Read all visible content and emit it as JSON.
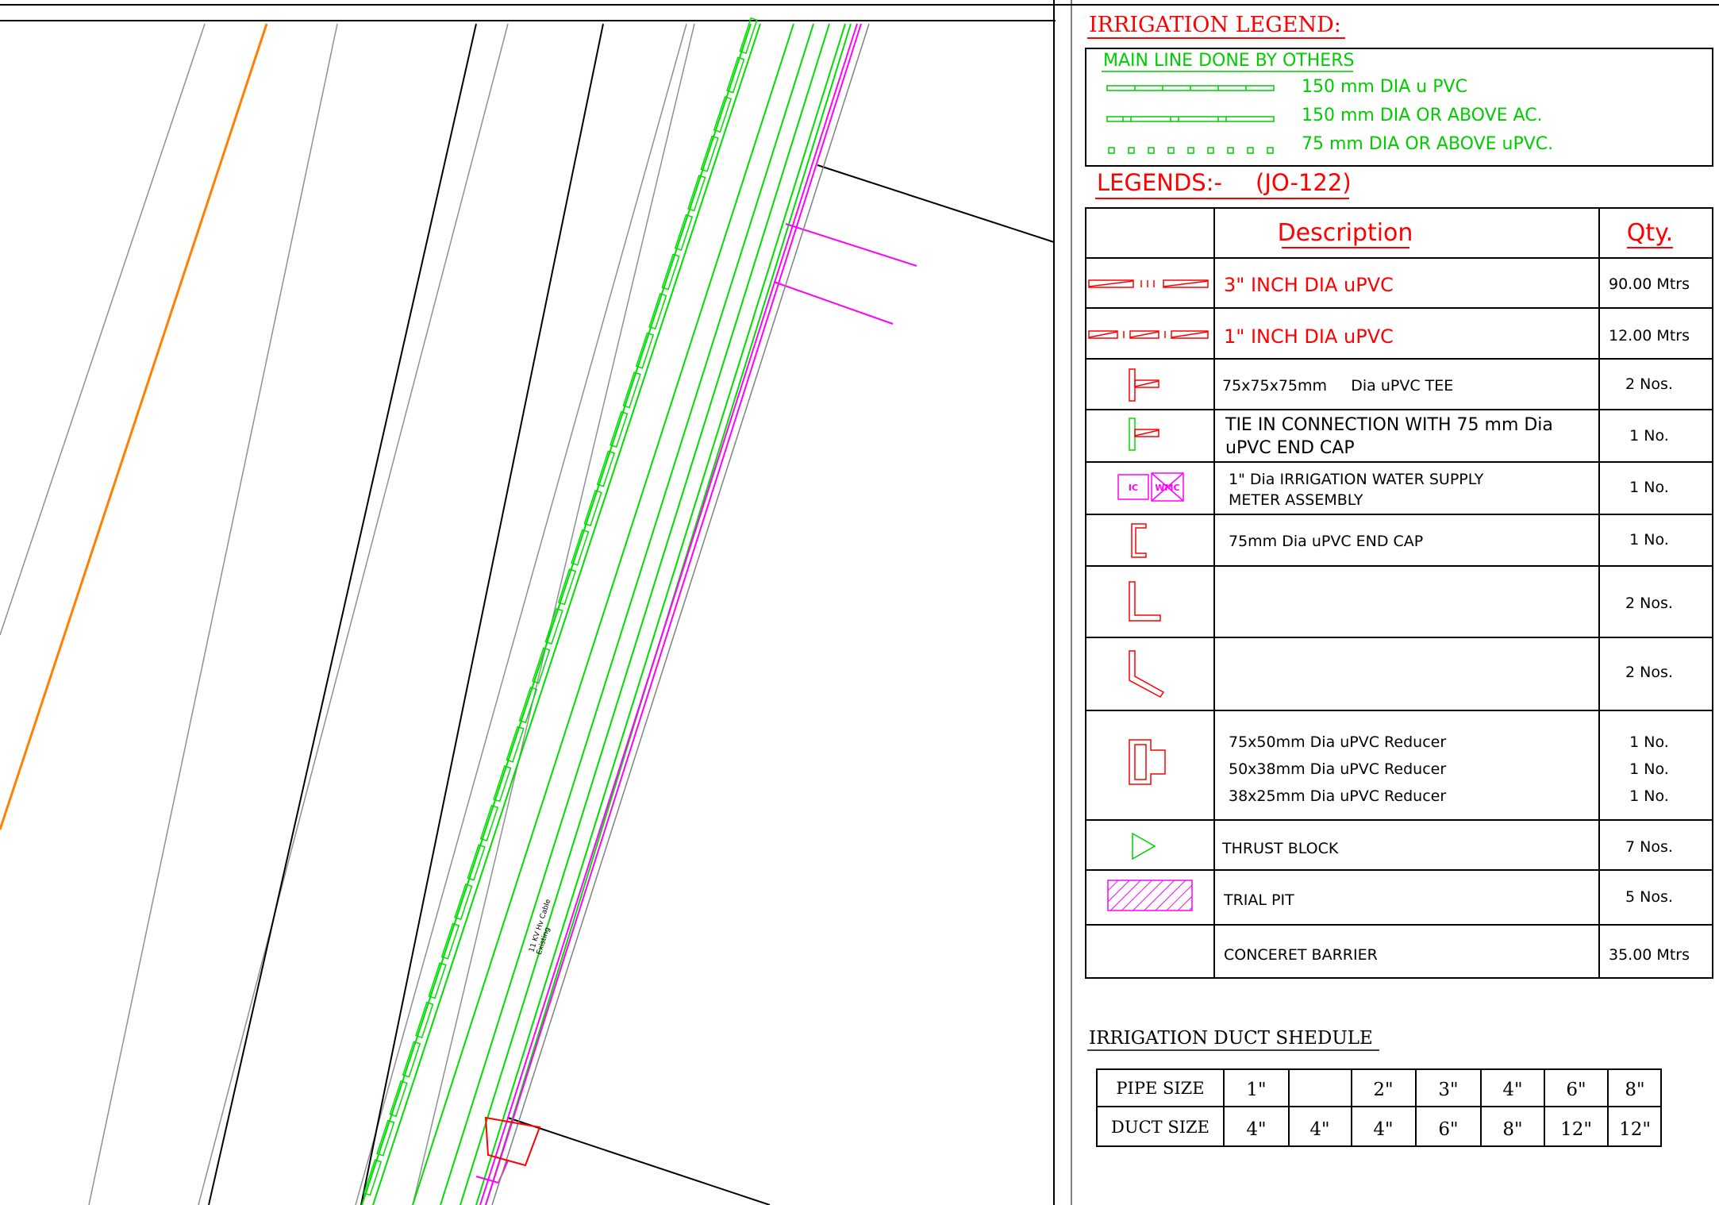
{
  "colors": {
    "red": "#ff0000",
    "green": "#00dd00",
    "magenta": "#ff00ff",
    "orange": "#ff8000",
    "black": "#000000",
    "grey": "#808080"
  },
  "irrigation_legend": {
    "title": "IRRIGATION LEGEND:",
    "main_line_title": "MAIN LINE DONE BY OTHERS",
    "lines": [
      "150 mm DIA u PVC",
      "150 mm DIA OR ABOVE AC.",
      "75 mm DIA OR ABOVE uPVC."
    ]
  },
  "legends": {
    "title": "LEGENDS:-",
    "code": "(JO-122)",
    "header": {
      "description": "Description",
      "qty": "Qty."
    },
    "rows": [
      {
        "symbol": "pipe-3inch-symbol",
        "description": "3\" INCH DIA uPVC",
        "qty": "90.00 Mtrs"
      },
      {
        "symbol": "pipe-1inch-symbol",
        "description": "1\" INCH DIA uPVC",
        "qty": "12.00 Mtrs"
      },
      {
        "symbol": "tee-symbol",
        "description": "75x75x75mm     Dia uPVC TEE",
        "qty": "2 Nos."
      },
      {
        "symbol": "tie-in-symbol",
        "description_1": "TIE IN CONNECTION WITH 75 mm Dia",
        "description_2": "uPVC END CAP",
        "qty": "1 No."
      },
      {
        "symbol": "meter-symbol",
        "description_1": "1\" Dia IRRIGATION WATER SUPPLY",
        "description_2": "METER ASSEMBLY",
        "qty": "1 No.",
        "symbol_labels": [
          "IC",
          "WMC"
        ]
      },
      {
        "symbol": "end-cap-symbol",
        "description": "75mm Dia uPVC END CAP",
        "qty": "1 No."
      },
      {
        "symbol": "elbow-90-symbol",
        "description": "",
        "qty": "2 Nos."
      },
      {
        "symbol": "elbow-45-symbol",
        "description": "",
        "qty": "2 Nos."
      },
      {
        "symbol": "reducer-symbol",
        "description_lines": [
          "75x50mm Dia uPVC Reducer",
          "50x38mm Dia uPVC Reducer",
          "38x25mm Dia uPVC Reducer"
        ],
        "qty_lines": [
          "1 No.",
          "1 No.",
          "1 No."
        ]
      },
      {
        "symbol": "thrust-block-symbol",
        "description": "THRUST BLOCK",
        "qty": "7 Nos."
      },
      {
        "symbol": "trial-pit-symbol",
        "description": "TRIAL PIT",
        "qty": "5 Nos."
      },
      {
        "symbol": "none",
        "description": "CONCERET BARRIER",
        "qty": "35.00 Mtrs"
      }
    ]
  },
  "duct_schedule": {
    "title": "IRRIGATION DUCT SHEDULE",
    "row_labels": [
      "PIPE SIZE",
      "DUCT SIZE"
    ],
    "pipe_sizes": [
      "1\"",
      "",
      "2\"",
      "3\"",
      "4\"",
      "6\"",
      "8\""
    ],
    "duct_sizes": [
      "4\"",
      "4\"",
      "4\"",
      "6\"",
      "8\"",
      "12\"",
      "12\""
    ]
  },
  "plan_annotation": {
    "line_1": "11 KV Hv Cable",
    "line_2": "Existing"
  }
}
